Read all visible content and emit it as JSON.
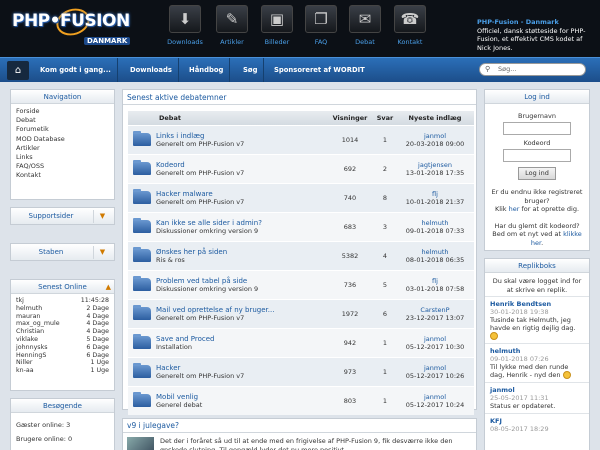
{
  "header": {
    "logo_main": "PHP•FUSION",
    "logo_sub": "DANMARK",
    "icons": [
      {
        "label": "Downloads",
        "icon": "download-icon",
        "glyph": "⬇"
      },
      {
        "label": "Artikler",
        "icon": "pen-icon",
        "glyph": "✎"
      },
      {
        "label": "Billeder",
        "icon": "picture-icon",
        "glyph": "▣"
      },
      {
        "label": "FAQ",
        "icon": "document-icon",
        "glyph": "❐"
      },
      {
        "label": "Debat",
        "icon": "chat-icon",
        "glyph": "✉"
      },
      {
        "label": "Kontakt",
        "icon": "contact-icon",
        "glyph": "☎"
      }
    ],
    "info_title": "PHP-Fusion - Danmark",
    "info_text": "Officiel, dansk støtteside for PHP-Fusion, et effektivt CMS kodet af Nick Jones."
  },
  "nav": {
    "items": [
      "Kom godt i gang...",
      "Downloads",
      "Håndbog",
      "Søg",
      "Sponsoreret af WORDIT"
    ],
    "search_placeholder": "Søg..."
  },
  "navigation": {
    "title": "Navigation",
    "items": [
      "Forside",
      "Debat",
      "Forumetik",
      "MOD Database",
      "Artikler",
      "Links",
      "FAQ/OSS",
      "Kontakt"
    ]
  },
  "supportsider": {
    "title": "Supportsider"
  },
  "staben": {
    "title": "Staben"
  },
  "online": {
    "title": "Senest Online",
    "rows": [
      {
        "name": "tkj",
        "time": "11:45:28"
      },
      {
        "name": "helmuth",
        "time": "2 Dage"
      },
      {
        "name": "mauran",
        "time": "4 Dage"
      },
      {
        "name": "max_og_mule",
        "time": "4 Dage"
      },
      {
        "name": "Christian",
        "time": "4 Dage"
      },
      {
        "name": "viklake",
        "time": "5 Dage"
      },
      {
        "name": "johnnysks",
        "time": "6 Dage"
      },
      {
        "name": "HenningS",
        "time": "6 Dage"
      },
      {
        "name": "Niller",
        "time": "1 Uge"
      },
      {
        "name": "kn-aa",
        "time": "1 Uge"
      }
    ]
  },
  "visitors": {
    "title": "Besøgende",
    "guests": "Gæster online: 3",
    "members": "Brugere online: 0"
  },
  "forum": {
    "title": "Senest aktive debatemner",
    "headers": {
      "topic": "Debat",
      "views": "Visninger",
      "replies": "Svar",
      "last": "Nyeste indlæg"
    },
    "rows": [
      {
        "title": "Links i indlæg",
        "forum": "Generelt om PHP-Fusion v7",
        "views": "1014",
        "replies": "1",
        "user": "janmol",
        "date": "20-03-2018 09:00"
      },
      {
        "title": "Kodeord",
        "forum": "Generelt om PHP-Fusion v7",
        "views": "692",
        "replies": "2",
        "user": "jagtjensen",
        "date": "13-01-2018 17:35"
      },
      {
        "title": "Hacker malware",
        "forum": "Generelt om PHP-Fusion v7",
        "views": "740",
        "replies": "8",
        "user": "flj",
        "date": "10-01-2018 21:37"
      },
      {
        "title": "Kan ikke se alle sider i admin?",
        "forum": "Diskussioner omkring version 9",
        "views": "683",
        "replies": "3",
        "user": "helmuth",
        "date": "09-01-2018 07:33"
      },
      {
        "title": "Ønskes her på siden",
        "forum": "Ris & ros",
        "views": "5382",
        "replies": "4",
        "user": "helmuth",
        "date": "08-01-2018 06:35"
      },
      {
        "title": "Problem ved tabel på side",
        "forum": "Diskussioner omkring version 9",
        "views": "736",
        "replies": "5",
        "user": "flj",
        "date": "03-01-2018 07:58"
      },
      {
        "title": "Mail ved oprettelse af ny bruger...",
        "forum": "Generelt om PHP-Fusion v7",
        "views": "1972",
        "replies": "6",
        "user": "CarstenP",
        "date": "23-12-2017 13:07"
      },
      {
        "title": "Save and Proced",
        "forum": "Installation",
        "views": "942",
        "replies": "1",
        "user": "janmol",
        "date": "05-12-2017 10:30"
      },
      {
        "title": "Hacker",
        "forum": "Generelt om PHP-Fusion v7",
        "views": "973",
        "replies": "1",
        "user": "janmol",
        "date": "05-12-2017 10:26"
      },
      {
        "title": "Mobil venlig",
        "forum": "Generel debat",
        "views": "803",
        "replies": "1",
        "user": "janmol",
        "date": "05-12-2017 10:24"
      }
    ]
  },
  "news": {
    "title": "v9 i julegave?",
    "text": "Det der i foråret så ud til at ende med en frigivelse af PHP-Fusion 9, fik desværre ikke den ønskede slutning. Til gengæld lyder det nu mere positivt"
  },
  "login": {
    "title": "Log ind",
    "username_label": "Brugernavn",
    "password_label": "Kodeord",
    "button": "Log ind",
    "register_q": "Er du endnu ikke registreret bruger?",
    "register_link_pre": "Klik ",
    "register_link": "her",
    "register_link_post": " for at oprette dig.",
    "forgot_q": "Har du glemt dit kodeord? Bed om et nyt ved at ",
    "forgot_link": "klikke her",
    "forgot_post": "."
  },
  "shoutbox": {
    "title": "Replikboks",
    "intro": "Du skal være logget ind for at skrive en replik.",
    "messages": [
      {
        "name": "Henrik Bendtsen",
        "date": "30-01-2018 19:38",
        "text": "Tusinde tak Helmuth, jeg havde en rigtig dejlig dag."
      },
      {
        "name": "helmuth",
        "date": "09-01-2018 07:26",
        "text": "Til lykke med den runde dag, Henrik - nyd den"
      },
      {
        "name": "janmol",
        "date": "25-05-2017 11:31",
        "text": "Status er opdateret."
      },
      {
        "name": "KFJ",
        "date": "08-05-2017 18:29",
        "text": ""
      }
    ]
  }
}
